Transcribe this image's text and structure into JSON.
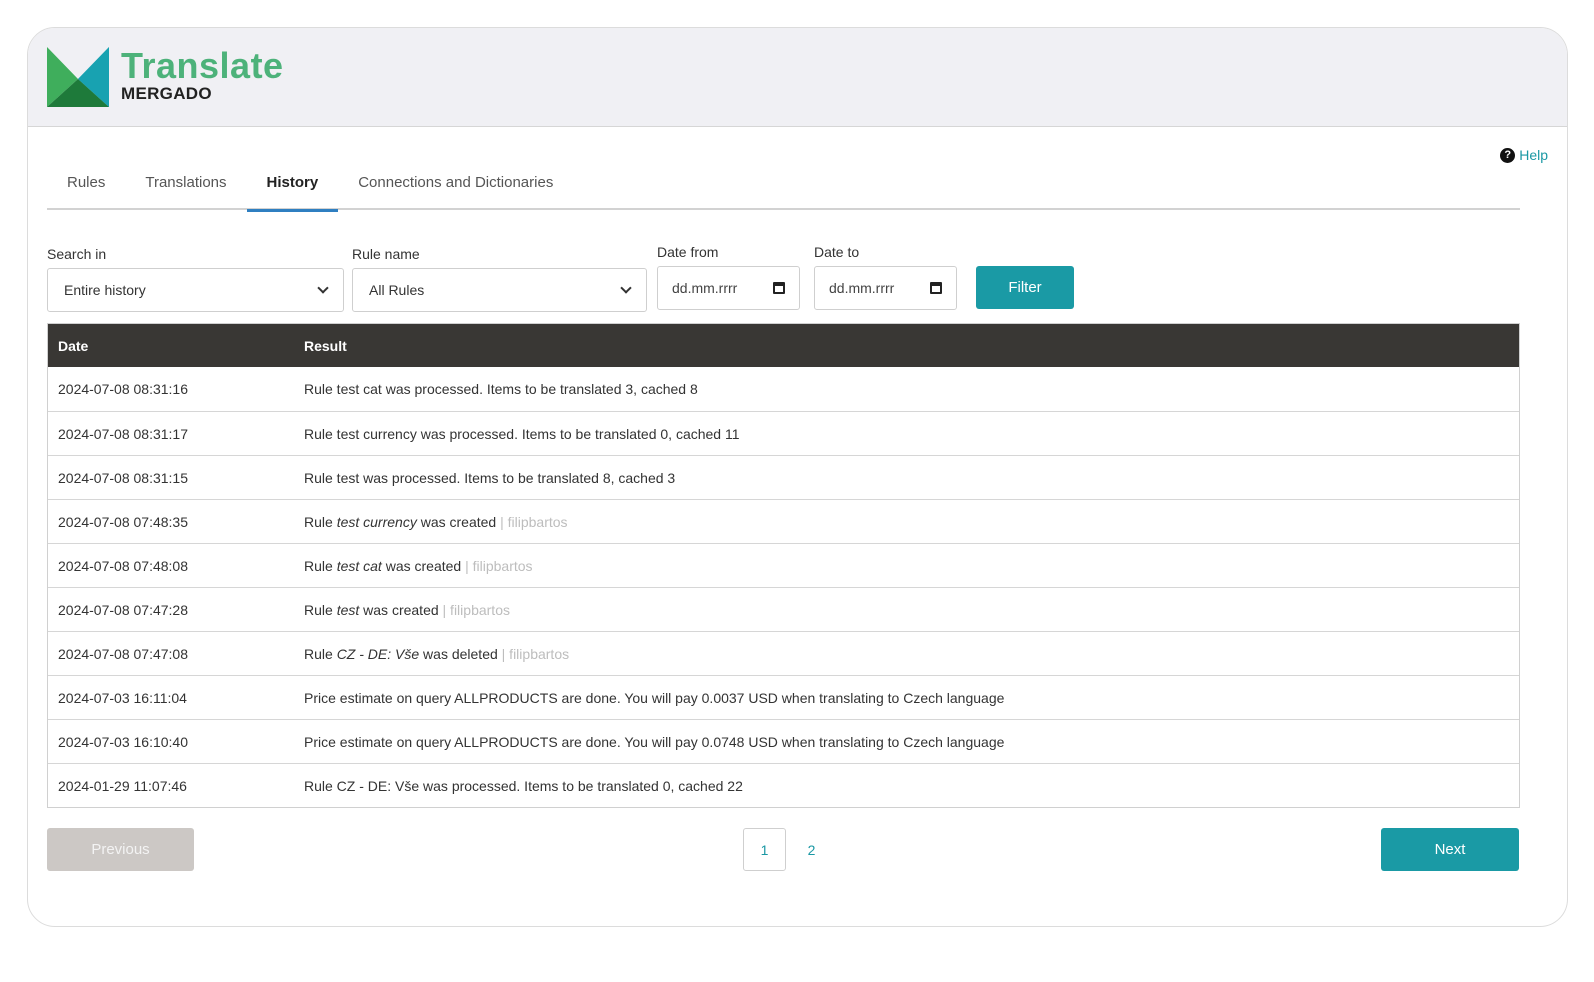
{
  "brand": {
    "title": "Translate",
    "subtitle": "MERGADO"
  },
  "colors": {
    "accent": "#1a9aa5",
    "tab_indicator": "#2f7fc1",
    "table_header": "#393734",
    "logo_green": "#4db27a"
  },
  "help": {
    "label": "Help",
    "icon": "question-circle-icon"
  },
  "tabs": [
    {
      "label": "Rules",
      "active": false
    },
    {
      "label": "Translations",
      "active": false
    },
    {
      "label": "History",
      "active": true
    },
    {
      "label": "Connections and Dictionaries",
      "active": false
    }
  ],
  "filters": {
    "search_in": {
      "label": "Search in",
      "value": "Entire history"
    },
    "rule_name": {
      "label": "Rule name",
      "value": "All Rules"
    },
    "date_from": {
      "label": "Date from",
      "placeholder": "dd.mm.rrrr"
    },
    "date_to": {
      "label": "Date to",
      "placeholder": "dd.mm.rrrr"
    },
    "filter_button": "Filter"
  },
  "table": {
    "headers": {
      "date": "Date",
      "result": "Result"
    },
    "rows": [
      {
        "date": "2024-07-08 08:31:16",
        "pre": "Rule test cat was processed. Items to be translated 3, cached 8",
        "em": "",
        "post": "",
        "user": ""
      },
      {
        "date": "2024-07-08 08:31:17",
        "pre": "Rule test currency was processed. Items to be translated 0, cached 11",
        "em": "",
        "post": "",
        "user": ""
      },
      {
        "date": "2024-07-08 08:31:15",
        "pre": "Rule test was processed. Items to be translated 8, cached 3",
        "em": "",
        "post": "",
        "user": ""
      },
      {
        "date": "2024-07-08 07:48:35",
        "pre": "Rule ",
        "em": "test currency",
        "post": " was created",
        "user": " | filipbartos"
      },
      {
        "date": "2024-07-08 07:48:08",
        "pre": "Rule ",
        "em": "test cat",
        "post": " was created",
        "user": " | filipbartos"
      },
      {
        "date": "2024-07-08 07:47:28",
        "pre": "Rule ",
        "em": "test",
        "post": " was created",
        "user": " | filipbartos"
      },
      {
        "date": "2024-07-08 07:47:08",
        "pre": "Rule ",
        "em": "CZ - DE: Vše",
        "post": " was deleted",
        "user": " | filipbartos"
      },
      {
        "date": "2024-07-03 16:11:04",
        "pre": "Price estimate on query ALLPRODUCTS are done. You will pay 0.0037 USD when translating to Czech language",
        "em": "",
        "post": "",
        "user": ""
      },
      {
        "date": "2024-07-03 16:10:40",
        "pre": "Price estimate on query ALLPRODUCTS are done. You will pay 0.0748 USD when translating to Czech language",
        "em": "",
        "post": "",
        "user": ""
      },
      {
        "date": "2024-01-29 11:07:46",
        "pre": "Rule CZ - DE: Vše was processed. Items to be translated 0, cached 22",
        "em": "",
        "post": "",
        "user": ""
      }
    ]
  },
  "pagination": {
    "previous": "Previous",
    "next": "Next",
    "pages": [
      "1",
      "2"
    ],
    "current": "1"
  }
}
